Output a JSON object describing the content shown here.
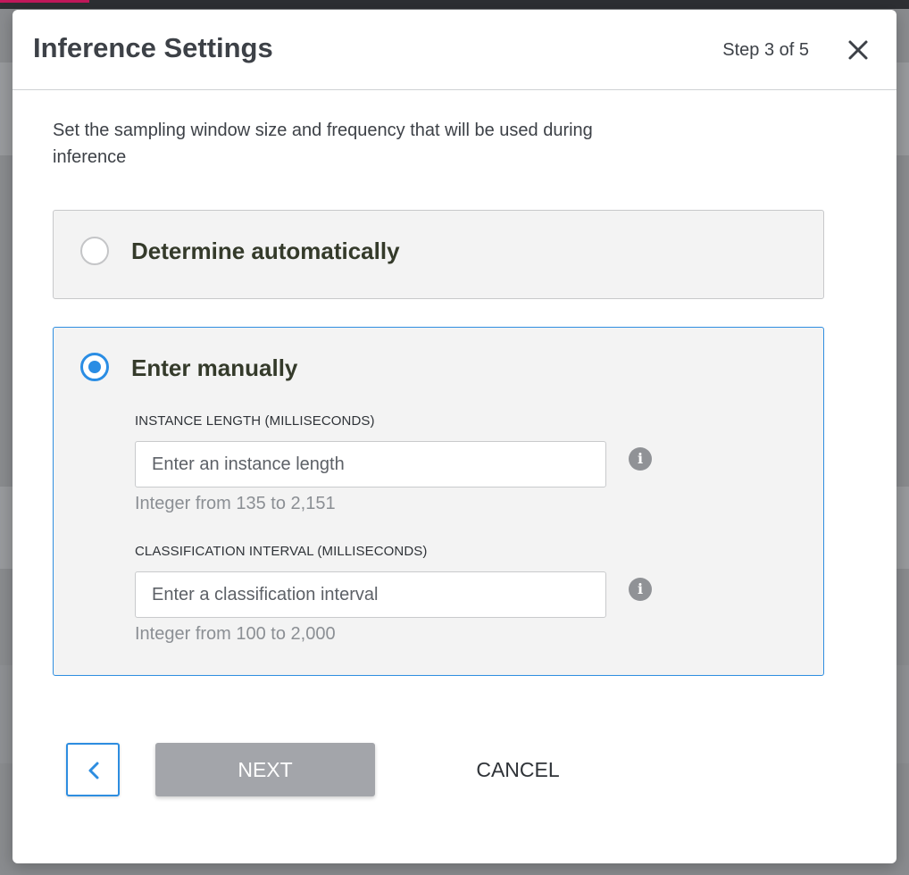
{
  "modal": {
    "title": "Inference Settings",
    "step": "Step 3 of 5",
    "intro": "Set the sampling window size and frequency that will be used during inference"
  },
  "options": {
    "auto": {
      "label": "Determine automatically",
      "selected": false
    },
    "manual": {
      "label": "Enter manually",
      "selected": true
    }
  },
  "fields": {
    "instance_length": {
      "label": "INSTANCE LENGTH (MILLISECONDS)",
      "placeholder": "Enter an instance length",
      "value": "",
      "hint": "Integer from 135 to 2,151"
    },
    "classification_interval": {
      "label": "CLASSIFICATION INTERVAL (MILLISECONDS)",
      "placeholder": "Enter a classification interval",
      "value": "",
      "hint": "Integer from 100 to 2,000"
    }
  },
  "footer": {
    "next_label": "NEXT",
    "cancel_label": "CANCEL"
  },
  "icons": {
    "close": "close-icon",
    "info": "info-icon",
    "back": "chevron-left-icon"
  },
  "colors": {
    "accent": "#2a8de4",
    "next_disabled": "#a3a5aa",
    "panel_bg": "#f3f3f3"
  }
}
